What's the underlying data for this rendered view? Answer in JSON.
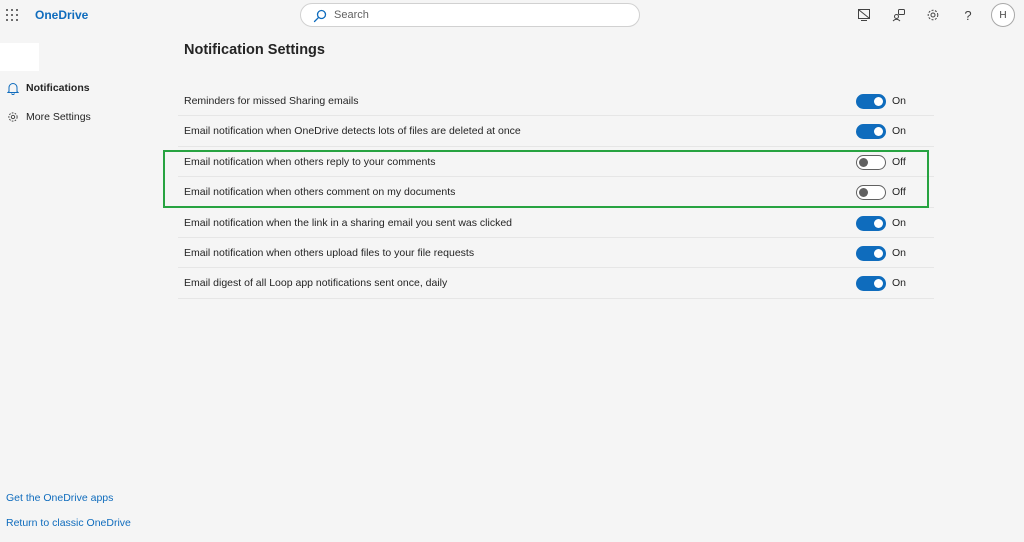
{
  "app": {
    "brand": "OneDrive"
  },
  "search": {
    "placeholder": "Search"
  },
  "header_icons": [
    "waffle-icon",
    "presentation-icon",
    "feedback-icon",
    "gear-icon",
    "help-icon"
  ],
  "user": {
    "initial": "H"
  },
  "sidebar": {
    "items": [
      {
        "label": "Notifications",
        "icon": "bell-icon",
        "active": true
      },
      {
        "label": "More Settings",
        "icon": "gear-icon",
        "active": false
      }
    ],
    "footer": {
      "get_apps": "Get the OneDrive apps",
      "classic": "Return to classic OneDrive"
    }
  },
  "main": {
    "title": "Notification Settings",
    "settings": [
      {
        "label": "Reminders for missed Sharing emails",
        "state": "On",
        "enabled": true
      },
      {
        "label": "Email notification when OneDrive detects lots of files are deleted at once",
        "state": "On",
        "enabled": true
      },
      {
        "label": "Email notification when others reply to your comments",
        "state": "Off",
        "enabled": false
      },
      {
        "label": "Email notification when others comment on my documents",
        "state": "Off",
        "enabled": false
      },
      {
        "label": "Email notification when the link in a sharing email you sent was clicked",
        "state": "On",
        "enabled": true
      },
      {
        "label": "Email notification when others upload files to your file requests",
        "state": "On",
        "enabled": true
      },
      {
        "label": "Email digest of all Loop app notifications sent once, daily",
        "state": "On",
        "enabled": true
      }
    ]
  },
  "colors": {
    "accent": "#0f6cbd",
    "highlight": "#27a341",
    "background": "#f5f5f5"
  }
}
